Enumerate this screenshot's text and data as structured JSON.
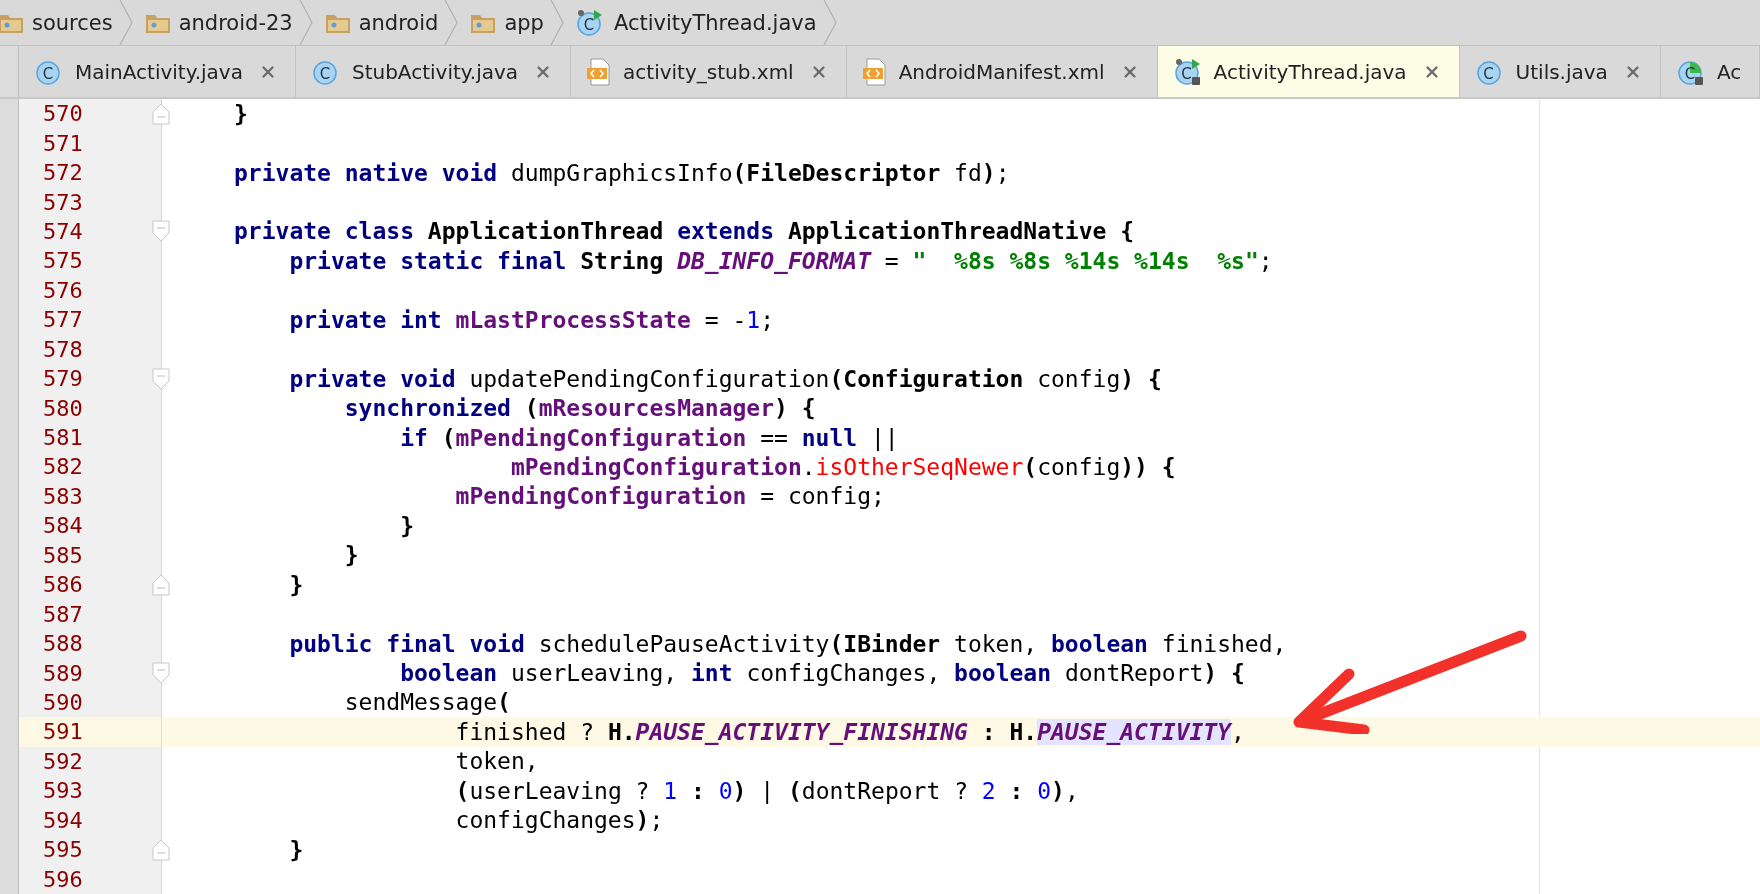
{
  "breadcrumbs": [
    {
      "label": "sources",
      "kind": "folder"
    },
    {
      "label": "android-23",
      "kind": "folder"
    },
    {
      "label": "android",
      "kind": "folder"
    },
    {
      "label": "app",
      "kind": "folder"
    },
    {
      "label": "ActivityThread.java",
      "kind": "class-run",
      "icon_text": "C"
    }
  ],
  "tabs": [
    {
      "label": "MainActivity.java",
      "kind": "class",
      "icon_text": "C",
      "selected": false,
      "closable": true
    },
    {
      "label": "StubActivity.java",
      "kind": "class",
      "icon_text": "C",
      "selected": false,
      "closable": true
    },
    {
      "label": "activity_stub.xml",
      "kind": "xml",
      "selected": false,
      "closable": true
    },
    {
      "label": "AndroidManifest.xml",
      "kind": "xml",
      "selected": false,
      "closable": true
    },
    {
      "label": "ActivityThread.java",
      "kind": "class-run-locked",
      "icon_text": "C",
      "selected": true,
      "closable": true
    },
    {
      "label": "Utils.java",
      "kind": "class",
      "icon_text": "C",
      "selected": false,
      "closable": true
    },
    {
      "label": "Ac",
      "kind": "class-pie-locked",
      "icon_text": "C",
      "selected": false,
      "closable": false
    }
  ],
  "editor": {
    "lines": [
      {
        "number": "570",
        "kind": "fold-end",
        "current": false,
        "tokens": [
          {
            "kind": "bold",
            "text": "}"
          }
        ]
      },
      {
        "number": "571",
        "kind": "plain",
        "current": false
      },
      {
        "number": "572",
        "kind": "plain",
        "current": false,
        "tokens": [
          {
            "kind": "keyword",
            "text": "private native void"
          },
          {
            "kind": "plain",
            "text": " dumpGraphicsInfo"
          },
          {
            "kind": "bold",
            "text": "(FileDescriptor"
          },
          {
            "kind": "plain",
            "text": " fd"
          },
          {
            "kind": "bold",
            "text": ")"
          },
          {
            "kind": "plain",
            "text": ";"
          }
        ]
      },
      {
        "number": "573",
        "kind": "plain",
        "current": false
      },
      {
        "number": "574",
        "kind": "fold-start",
        "current": false,
        "tokens": [
          {
            "kind": "keyword",
            "text": "private class"
          },
          {
            "kind": "bold",
            "text": " ApplicationThread "
          },
          {
            "kind": "keyword",
            "text": "extends"
          },
          {
            "kind": "bold",
            "text": " ApplicationThreadNative {"
          }
        ]
      },
      {
        "number": "575",
        "kind": "plain",
        "current": false,
        "tokens": [
          {
            "kind": "keyword",
            "text": "    private static final"
          },
          {
            "kind": "bold",
            "text": " String "
          },
          {
            "kind": "constant",
            "text": "DB_INFO_FORMAT"
          },
          {
            "kind": "plain",
            "text": " = "
          },
          {
            "kind": "string",
            "text": "\"  %8s %8s %14s %14s  %s\""
          },
          {
            "kind": "plain",
            "text": ";"
          }
        ]
      },
      {
        "number": "576",
        "kind": "plain",
        "current": false
      },
      {
        "number": "577",
        "kind": "plain",
        "current": false,
        "tokens": [
          {
            "kind": "keyword",
            "text": "    private int"
          },
          {
            "kind": "field",
            "text": " mLastProcessState"
          },
          {
            "kind": "plain",
            "text": " = -"
          },
          {
            "kind": "number",
            "text": "1"
          },
          {
            "kind": "plain",
            "text": ";"
          }
        ]
      },
      {
        "number": "578",
        "kind": "plain",
        "current": false
      },
      {
        "number": "579",
        "kind": "fold-start",
        "current": false,
        "tokens": [
          {
            "kind": "keyword",
            "text": "    private void"
          },
          {
            "kind": "plain",
            "text": " updatePendingConfiguration"
          },
          {
            "kind": "bold",
            "text": "(Configuration"
          },
          {
            "kind": "plain",
            "text": " config"
          },
          {
            "kind": "bold",
            "text": ") {"
          }
        ]
      },
      {
        "number": "580",
        "kind": "plain",
        "current": false,
        "tokens": [
          {
            "kind": "keyword",
            "text": "        synchronized"
          },
          {
            "kind": "bold",
            "text": " ("
          },
          {
            "kind": "field",
            "text": "mResourcesManager"
          },
          {
            "kind": "bold",
            "text": ") {"
          }
        ]
      },
      {
        "number": "581",
        "kind": "plain",
        "current": false,
        "tokens": [
          {
            "kind": "keyword",
            "text": "            if"
          },
          {
            "kind": "bold",
            "text": " ("
          },
          {
            "kind": "field",
            "text": "mPendingConfiguration"
          },
          {
            "kind": "plain",
            "text": " == "
          },
          {
            "kind": "keyword",
            "text": "null"
          },
          {
            "kind": "plain",
            "text": " ||"
          }
        ]
      },
      {
        "number": "582",
        "kind": "plain",
        "current": false,
        "tokens": [
          {
            "kind": "field",
            "text": "                    mPendingConfiguration"
          },
          {
            "kind": "plain",
            "text": "."
          },
          {
            "kind": "error",
            "text": "isOtherSeqNewer"
          },
          {
            "kind": "bold",
            "text": "("
          },
          {
            "kind": "plain",
            "text": "config"
          },
          {
            "kind": "bold",
            "text": ")) {"
          }
        ]
      },
      {
        "number": "583",
        "kind": "plain",
        "current": false,
        "tokens": [
          {
            "kind": "field",
            "text": "                mPendingConfiguration"
          },
          {
            "kind": "plain",
            "text": " = config;"
          }
        ]
      },
      {
        "number": "584",
        "kind": "plain",
        "current": false,
        "tokens": [
          {
            "kind": "bold",
            "text": "            }"
          }
        ]
      },
      {
        "number": "585",
        "kind": "plain",
        "current": false,
        "tokens": [
          {
            "kind": "bold",
            "text": "        }"
          }
        ]
      },
      {
        "number": "586",
        "kind": "fold-end",
        "current": false,
        "tokens": [
          {
            "kind": "bold",
            "text": "    }"
          }
        ]
      },
      {
        "number": "587",
        "kind": "plain",
        "current": false
      },
      {
        "number": "588",
        "kind": "plain",
        "current": false,
        "tokens": [
          {
            "kind": "keyword",
            "text": "    public final void"
          },
          {
            "kind": "plain",
            "text": " schedulePauseActivity"
          },
          {
            "kind": "bold",
            "text": "(IBinder"
          },
          {
            "kind": "plain",
            "text": " token, "
          },
          {
            "kind": "keyword",
            "text": "boolean"
          },
          {
            "kind": "plain",
            "text": " finished,"
          }
        ]
      },
      {
        "number": "589",
        "kind": "fold-start",
        "current": false,
        "tokens": [
          {
            "kind": "keyword",
            "text": "            boolean"
          },
          {
            "kind": "plain",
            "text": " userLeaving, "
          },
          {
            "kind": "keyword",
            "text": "int"
          },
          {
            "kind": "plain",
            "text": " configChanges, "
          },
          {
            "kind": "keyword",
            "text": "boolean"
          },
          {
            "kind": "plain",
            "text": " dontReport"
          },
          {
            "kind": "bold",
            "text": ") {"
          }
        ]
      },
      {
        "number": "590",
        "kind": "plain",
        "current": false,
        "tokens": [
          {
            "kind": "plain",
            "text": "        sendMessage"
          },
          {
            "kind": "bold",
            "text": "("
          }
        ]
      },
      {
        "number": "591",
        "kind": "plain",
        "current": true,
        "tokens": [
          {
            "kind": "plain",
            "text": "                finished ? "
          },
          {
            "kind": "bold",
            "text": "H."
          },
          {
            "kind": "constant",
            "text": "PAUSE_ACTIVITY_FINISHING"
          },
          {
            "kind": "bold",
            "text": " : H."
          },
          {
            "kind": "constant",
            "text": "PAUSE_ACTIVITY",
            "highlighted": true
          },
          {
            "kind": "plain",
            "text": ","
          }
        ]
      },
      {
        "number": "592",
        "kind": "plain",
        "current": false,
        "tokens": [
          {
            "kind": "plain",
            "text": "                token,"
          }
        ]
      },
      {
        "number": "593",
        "kind": "plain",
        "current": false,
        "tokens": [
          {
            "kind": "bold",
            "text": "                ("
          },
          {
            "kind": "plain",
            "text": "userLeaving ? "
          },
          {
            "kind": "number",
            "text": "1"
          },
          {
            "kind": "bold",
            "text": " : "
          },
          {
            "kind": "number",
            "text": "0"
          },
          {
            "kind": "bold",
            "text": ")"
          },
          {
            "kind": "plain",
            "text": " | "
          },
          {
            "kind": "bold",
            "text": "("
          },
          {
            "kind": "plain",
            "text": "dontReport ? "
          },
          {
            "kind": "number",
            "text": "2"
          },
          {
            "kind": "bold",
            "text": " : "
          },
          {
            "kind": "number",
            "text": "0"
          },
          {
            "kind": "bold",
            "text": ")"
          },
          {
            "kind": "plain",
            "text": ","
          }
        ]
      },
      {
        "number": "594",
        "kind": "plain",
        "current": false,
        "tokens": [
          {
            "kind": "plain",
            "text": "                configChanges"
          },
          {
            "kind": "bold",
            "text": ")"
          },
          {
            "kind": "plain",
            "text": ";"
          }
        ]
      },
      {
        "number": "595",
        "kind": "fold-end",
        "current": false,
        "tokens": [
          {
            "kind": "bold",
            "text": "    }"
          }
        ]
      },
      {
        "number": "596",
        "kind": "plain",
        "current": false
      }
    ]
  }
}
